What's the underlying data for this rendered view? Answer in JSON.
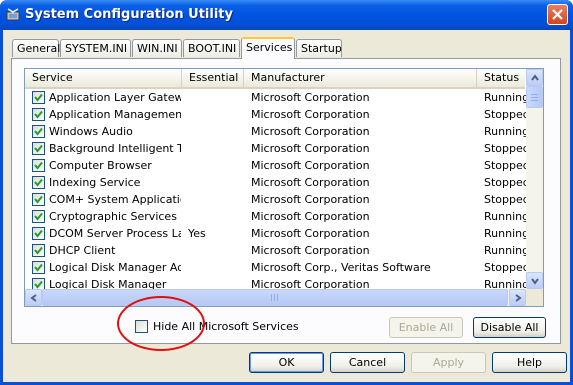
{
  "window": {
    "title": "System Configuration Utility",
    "icon": "msconfig-icon",
    "close_icon": "close-icon"
  },
  "tabs": [
    {
      "label": "General",
      "active": false
    },
    {
      "label": "SYSTEM.INI",
      "active": false
    },
    {
      "label": "WIN.INI",
      "active": false
    },
    {
      "label": "BOOT.INI",
      "active": false
    },
    {
      "label": "Services",
      "active": true
    },
    {
      "label": "Startup",
      "active": false
    }
  ],
  "services": {
    "columns": [
      "Service",
      "Essential",
      "Manufacturer",
      "Status"
    ],
    "rows": [
      {
        "checked": true,
        "service": "Application Layer Gatew...",
        "essential": "",
        "manufacturer": "Microsoft Corporation",
        "status": "Running"
      },
      {
        "checked": true,
        "service": "Application Management",
        "essential": "",
        "manufacturer": "Microsoft Corporation",
        "status": "Stopped"
      },
      {
        "checked": true,
        "service": "Windows Audio",
        "essential": "",
        "manufacturer": "Microsoft Corporation",
        "status": "Running"
      },
      {
        "checked": true,
        "service": "Background Intelligent T...",
        "essential": "",
        "manufacturer": "Microsoft Corporation",
        "status": "Stopped"
      },
      {
        "checked": true,
        "service": "Computer Browser",
        "essential": "",
        "manufacturer": "Microsoft Corporation",
        "status": "Stopped"
      },
      {
        "checked": true,
        "service": "Indexing Service",
        "essential": "",
        "manufacturer": "Microsoft Corporation",
        "status": "Stopped"
      },
      {
        "checked": true,
        "service": "COM+ System Application",
        "essential": "",
        "manufacturer": "Microsoft Corporation",
        "status": "Stopped"
      },
      {
        "checked": true,
        "service": "Cryptographic Services",
        "essential": "",
        "manufacturer": "Microsoft Corporation",
        "status": "Running"
      },
      {
        "checked": true,
        "service": "DCOM Server Process La...",
        "essential": "Yes",
        "manufacturer": "Microsoft Corporation",
        "status": "Running"
      },
      {
        "checked": true,
        "service": "DHCP Client",
        "essential": "",
        "manufacturer": "Microsoft Corporation",
        "status": "Running"
      },
      {
        "checked": true,
        "service": "Logical Disk Manager Ad...",
        "essential": "",
        "manufacturer": "Microsoft Corp., Veritas Software",
        "status": "Stopped"
      },
      {
        "checked": true,
        "service": "Logical Disk Manager",
        "essential": "",
        "manufacturer": "Microsoft Corporation",
        "status": "Running"
      }
    ]
  },
  "hide_ms_services": {
    "label": "Hide All Microsoft Services",
    "checked": false
  },
  "buttons": {
    "enable_all": "Enable All",
    "disable_all": "Disable All",
    "ok": "OK",
    "cancel": "Cancel",
    "apply": "Apply",
    "help": "Help"
  },
  "colors": {
    "title_bar": "#0054e3",
    "dialog_bg": "#ece9d8",
    "annotation": "#e01010",
    "active_tab_accent": "#ffc83c"
  }
}
